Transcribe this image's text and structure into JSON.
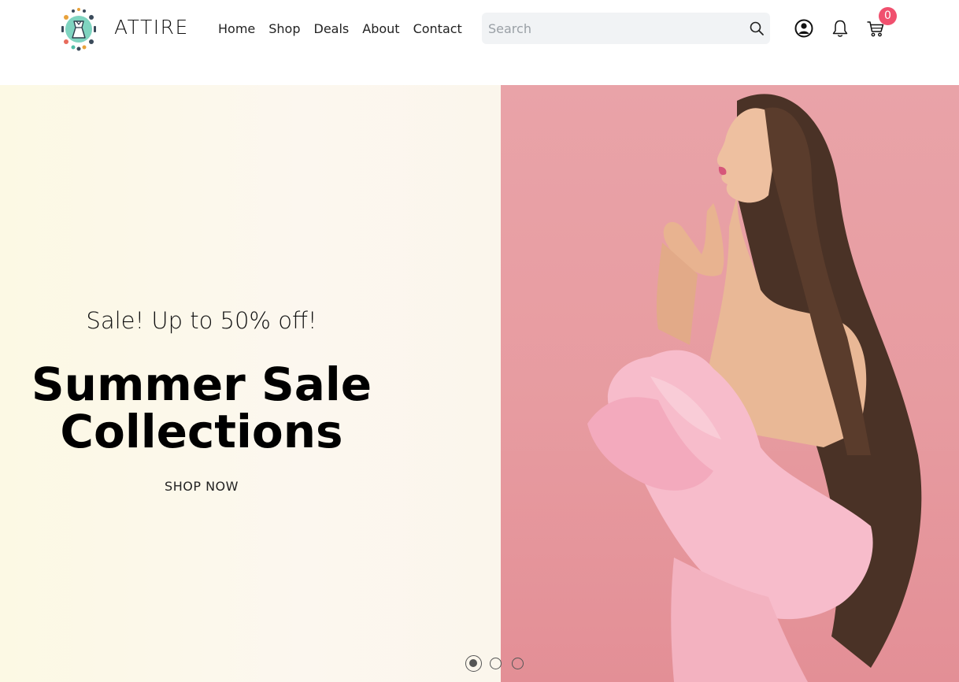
{
  "header": {
    "brand": "ATTIRE",
    "nav": [
      "Home",
      "Shop",
      "Deals",
      "About",
      "Contact"
    ],
    "search_placeholder": "Search",
    "cart_count": "0",
    "icons": [
      "user-circle-icon",
      "bell-icon",
      "cart-icon",
      "search-icon"
    ]
  },
  "hero": {
    "subtitle": "Sale! Up to 50% off!",
    "title_line1": "Summer Sale",
    "title_line2": "Collections",
    "cta": "SHOP NOW",
    "slides": 3,
    "active_slide": 1
  },
  "colors": {
    "badge": "#f0506e",
    "hero_left_bg": "#fcf8ea",
    "hero_right_bg": "#e79ba0",
    "dress": "#f6b6c4"
  }
}
